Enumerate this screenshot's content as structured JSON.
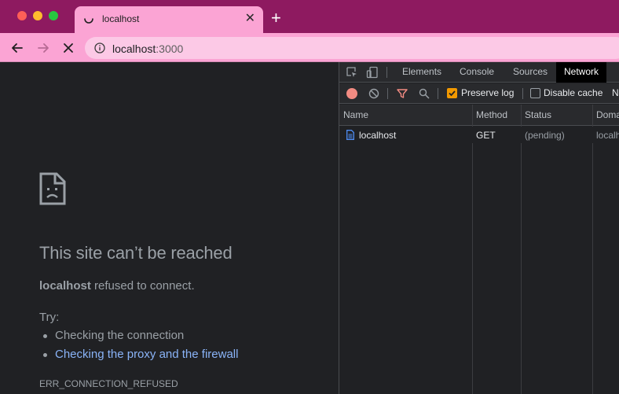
{
  "tab": {
    "title": "localhost",
    "close_glyph": "✕",
    "new_tab_glyph": "+"
  },
  "address": {
    "host": "localhost",
    "port": ":3000"
  },
  "page": {
    "title": "This site can’t be reached",
    "desc_host": "localhost",
    "desc_rest": " refused to connect.",
    "try_label": "Try:",
    "suggestions": [
      "Checking the connection",
      "Checking the proxy and the firewall"
    ],
    "error_code": "ERR_CONNECTION_REFUSED"
  },
  "devtools": {
    "tabs": [
      "Elements",
      "Console",
      "Sources",
      "Network"
    ],
    "active_tab": "Network",
    "toolbar": {
      "preserve_log": "Preserve log",
      "preserve_log_checked": true,
      "disable_cache": "Disable cache",
      "disable_cache_checked": false,
      "overflow_label": "No"
    },
    "columns": [
      "Name",
      "Method",
      "Status",
      "Doma"
    ],
    "rows": [
      {
        "name": "localhost",
        "method": "GET",
        "status": "(pending)",
        "domain": "localh"
      }
    ]
  },
  "colors": {
    "tab_strip": "#8e1a60",
    "toolbar": "#fba4d4",
    "link": "#8ab4f8",
    "record": "#f28b82",
    "checkbox": "#f29900"
  }
}
